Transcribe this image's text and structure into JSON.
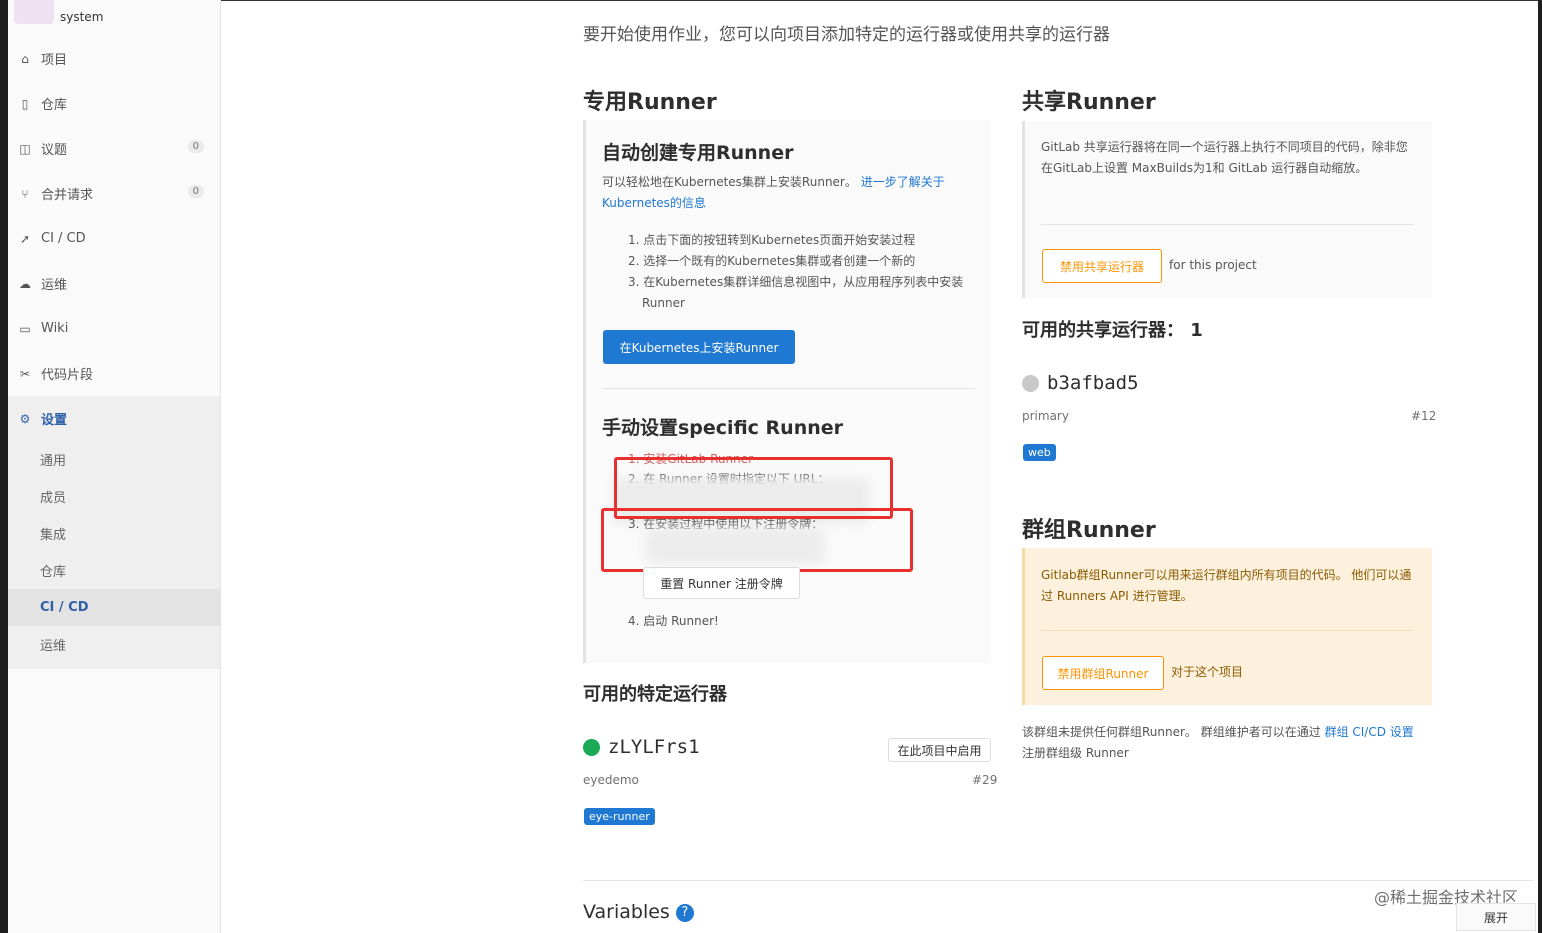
{
  "sidebar": {
    "project_name": "system",
    "items": [
      {
        "label": "项目",
        "icon": "home-icon"
      },
      {
        "label": "仓库",
        "icon": "doc-icon"
      },
      {
        "label": "议题",
        "icon": "issues-icon",
        "count": "0"
      },
      {
        "label": "合并请求",
        "icon": "merge-icon",
        "count": "0"
      },
      {
        "label": "CI / CD",
        "icon": "rocket-icon"
      },
      {
        "label": "运维",
        "icon": "cloud-icon"
      },
      {
        "label": "Wiki",
        "icon": "book-icon"
      },
      {
        "label": "代码片段",
        "icon": "scissors-icon"
      },
      {
        "label": "设置",
        "icon": "gear-icon"
      }
    ],
    "sub_items": [
      "通用",
      "成员",
      "集成",
      "仓库",
      "CI / CD",
      "运维"
    ]
  },
  "main": {
    "intro": "要开始使用作业，您可以向项目添加特定的运行器或使用共享的运行器",
    "specific": {
      "title": "专用Runner",
      "auto_title": "自动创建专用Runner",
      "auto_desc": "可以轻松地在Kubernetes集群上安装Runner。",
      "auto_link": "进一步了解关于Kubernetes的信息",
      "steps": [
        "1. 点击下面的按钮转到Kubernetes页面开始安装过程",
        "2. 选择一个既有的Kubernetes集群或者创建一个新的",
        "3. 在Kubernetes集群详细信息视图中，从应用程序列表中安装Runner"
      ],
      "install_button": "在Kubernetes上安装Runner",
      "manual_title": "手动设置specific Runner",
      "manual_step1": "1. 安装GitLab Runner",
      "manual_step2": "2. 在 Runner 设置时指定以下 URL：",
      "manual_step3": "3. 在安装过程中使用以下注册令牌：",
      "reset_button": "重置 Runner 注册令牌",
      "manual_step4": "4. 启动 Runner!"
    },
    "available_specific": {
      "title": "可用的特定运行器",
      "runner_name": "zLYLFrs1",
      "enable_button": "在此项目中启用",
      "desc": "eyedemo",
      "id": "#29",
      "tag": "eye-runner"
    },
    "variables_title": "Variables",
    "shared": {
      "title": "共享Runner",
      "desc": "GitLab 共享运行器将在同一个运行器上执行不同项目的代码，除非您在GitLab上设置 MaxBuilds为1和 GitLab 运行器自动缩放。",
      "disable_button": "禁用共享运行器",
      "for_project": "for this project",
      "available_title": "可用的共享运行器：  1",
      "runner_name": "b3afbad5",
      "runner_desc": "primary",
      "runner_id": "#12",
      "runner_tag": "web"
    },
    "group": {
      "title": "群组Runner",
      "desc": "Gitlab群组Runner可以用来运行群组内所有项目的代码。 他们可以通过 Runners API 进行管理。",
      "disable_button": "禁用群组Runner",
      "for_project": "对于这个项目",
      "none_text": "该群组未提供任何群组Runner。 群组维护者可以在通过",
      "none_link": "群组 CI/CD 设置",
      "none_suffix": "注册群组级 Runner"
    }
  },
  "watermark": "@稀土掘金技术社区",
  "expand_label": "展开",
  "colors": {
    "accent": "#1f78d1",
    "orange": "#fc9403",
    "green_status": "#1aaa55",
    "red_highlight": "#e8312f"
  }
}
